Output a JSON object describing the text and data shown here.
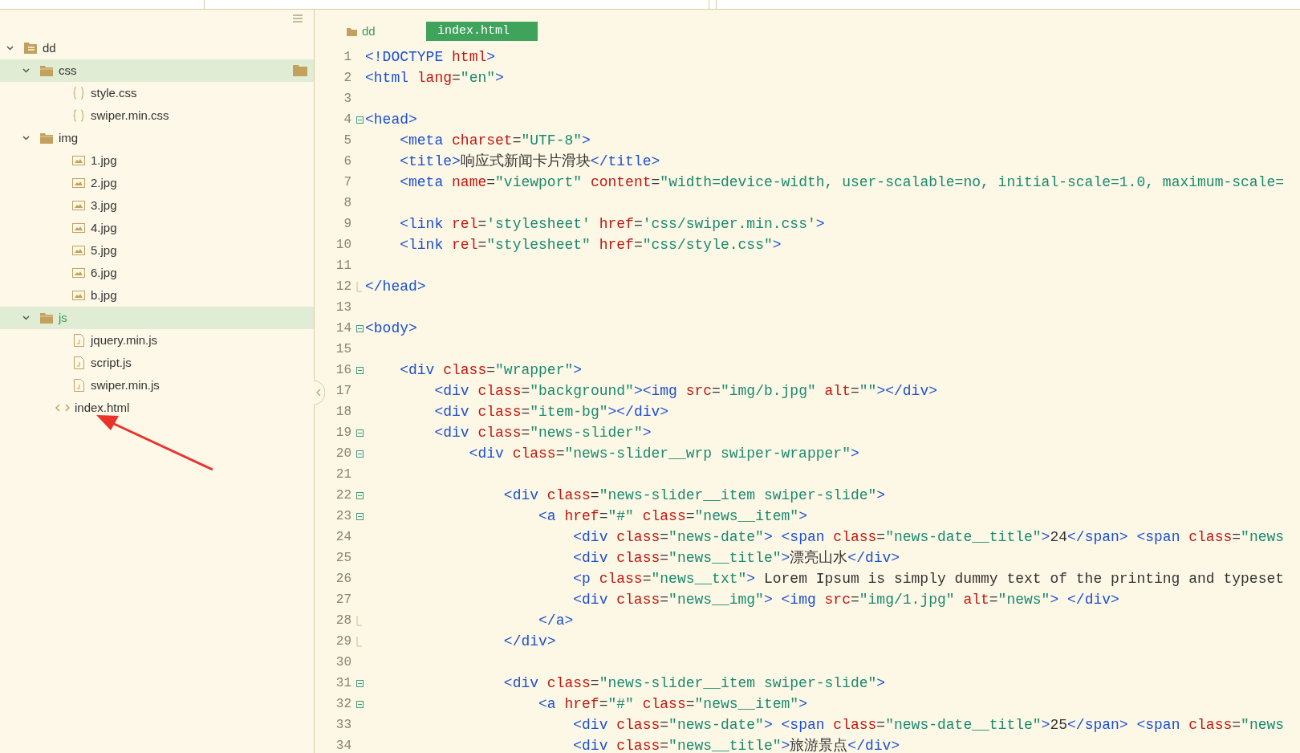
{
  "sidebar": {
    "tree": [
      {
        "label": "dd",
        "kind": "project",
        "expanded": true,
        "selected": false,
        "hovered": false,
        "children": [
          {
            "label": "css",
            "kind": "folder",
            "expanded": true,
            "selected": false,
            "hovered": true,
            "children": [
              {
                "label": "style.css",
                "kind": "css",
                "selected": false,
                "hovered": false
              },
              {
                "label": "swiper.min.css",
                "kind": "css",
                "selected": false,
                "hovered": false
              }
            ]
          },
          {
            "label": "img",
            "kind": "folder",
            "expanded": true,
            "selected": false,
            "hovered": false,
            "children": [
              {
                "label": "1.jpg",
                "kind": "image",
                "selected": false,
                "hovered": false
              },
              {
                "label": "2.jpg",
                "kind": "image",
                "selected": false,
                "hovered": false
              },
              {
                "label": "3.jpg",
                "kind": "image",
                "selected": false,
                "hovered": false
              },
              {
                "label": "4.jpg",
                "kind": "image",
                "selected": false,
                "hovered": false
              },
              {
                "label": "5.jpg",
                "kind": "image",
                "selected": false,
                "hovered": false
              },
              {
                "label": "6.jpg",
                "kind": "image",
                "selected": false,
                "hovered": false
              },
              {
                "label": "b.jpg",
                "kind": "image",
                "selected": false,
                "hovered": false
              }
            ]
          },
          {
            "label": "js",
            "kind": "folder",
            "expanded": true,
            "selected": true,
            "hovered": false,
            "children": [
              {
                "label": "jquery.min.js",
                "kind": "script",
                "selected": false,
                "hovered": false
              },
              {
                "label": "script.js",
                "kind": "script",
                "selected": false,
                "hovered": false
              },
              {
                "label": "swiper.min.js",
                "kind": "script",
                "selected": false,
                "hovered": false
              }
            ]
          },
          {
            "label": "index.html",
            "kind": "html",
            "selected": false,
            "hovered": false
          }
        ]
      }
    ]
  },
  "editor": {
    "breadcrumb": "dd",
    "tabs": [
      {
        "label": "index.html",
        "selected": true
      }
    ],
    "lines": [
      {
        "number": "1",
        "kind": "plain",
        "segments": [
          {
            "kind": "tag",
            "text": "<!DOCTYPE "
          },
          {
            "kind": "attr",
            "text": "html"
          },
          {
            "kind": "tag",
            "text": ">"
          }
        ]
      },
      {
        "number": "2",
        "kind": "plain",
        "segments": [
          {
            "kind": "tag",
            "text": "<html "
          },
          {
            "kind": "attr",
            "text": "lang"
          },
          {
            "kind": "plain",
            "text": "="
          },
          {
            "kind": "string",
            "text": "\"en\""
          },
          {
            "kind": "tag",
            "text": ">"
          }
        ]
      },
      {
        "number": "3",
        "kind": "plain"
      },
      {
        "number": "4",
        "kind": "fold_start",
        "segments": [
          {
            "kind": "tag",
            "text": "<head>"
          }
        ]
      },
      {
        "number": "5",
        "kind": "plain",
        "segments": [
          {
            "kind": "tag",
            "text": "    <meta "
          },
          {
            "kind": "attr",
            "text": "charset"
          },
          {
            "kind": "plain",
            "text": "="
          },
          {
            "kind": "string",
            "text": "\"UTF-8\""
          },
          {
            "kind": "tag",
            "text": ">"
          }
        ]
      },
      {
        "number": "6",
        "kind": "plain",
        "segments": [
          {
            "kind": "tag",
            "text": "    <title>"
          },
          {
            "kind": "plain",
            "text": "响应式新闻卡片滑块"
          },
          {
            "kind": "tag",
            "text": "</title>"
          }
        ]
      },
      {
        "number": "7",
        "kind": "plain",
        "segments": [
          {
            "kind": "tag",
            "text": "    <meta "
          },
          {
            "kind": "attr",
            "text": "name"
          },
          {
            "kind": "plain",
            "text": "="
          },
          {
            "kind": "string",
            "text": "\"viewport\" "
          },
          {
            "kind": "attr",
            "text": "content"
          },
          {
            "kind": "plain",
            "text": "="
          },
          {
            "kind": "string",
            "text": "\"width=device-width, user-scalable=no, initial-scale=1.0, maximum-scale="
          }
        ]
      },
      {
        "number": "8",
        "kind": "plain"
      },
      {
        "number": "9",
        "kind": "plain",
        "segments": [
          {
            "kind": "tag",
            "text": "    <link "
          },
          {
            "kind": "attr",
            "text": "rel"
          },
          {
            "kind": "plain",
            "text": "="
          },
          {
            "kind": "string",
            "text": "'stylesheet' "
          },
          {
            "kind": "attr",
            "text": "href"
          },
          {
            "kind": "plain",
            "text": "="
          },
          {
            "kind": "string",
            "text": "'css/swiper.min.css'"
          },
          {
            "kind": "tag",
            "text": ">"
          }
        ]
      },
      {
        "number": "10",
        "kind": "plain",
        "segments": [
          {
            "kind": "tag",
            "text": "    <link "
          },
          {
            "kind": "attr",
            "text": "rel"
          },
          {
            "kind": "plain",
            "text": "="
          },
          {
            "kind": "string",
            "text": "\"stylesheet\" "
          },
          {
            "kind": "attr",
            "text": "href"
          },
          {
            "kind": "plain",
            "text": "="
          },
          {
            "kind": "string",
            "text": "\"css/style.css\""
          },
          {
            "kind": "tag",
            "text": ">"
          }
        ]
      },
      {
        "number": "11",
        "kind": "plain"
      },
      {
        "number": "12",
        "kind": "fold_end",
        "segments": [
          {
            "kind": "tag",
            "text": "</head>"
          }
        ]
      },
      {
        "number": "13",
        "kind": "plain"
      },
      {
        "number": "14",
        "kind": "fold_start",
        "segments": [
          {
            "kind": "tag",
            "text": "<body>"
          }
        ]
      },
      {
        "number": "15",
        "kind": "plain"
      },
      {
        "number": "16",
        "kind": "fold_start",
        "segments": [
          {
            "kind": "tag",
            "text": "    <div "
          },
          {
            "kind": "attr",
            "text": "class"
          },
          {
            "kind": "plain",
            "text": "="
          },
          {
            "kind": "string",
            "text": "\"wrapper\""
          },
          {
            "kind": "tag",
            "text": ">"
          }
        ]
      },
      {
        "number": "17",
        "kind": "plain",
        "segments": [
          {
            "kind": "tag",
            "text": "        <div "
          },
          {
            "kind": "attr",
            "text": "class"
          },
          {
            "kind": "plain",
            "text": "="
          },
          {
            "kind": "string",
            "text": "\"background\""
          },
          {
            "kind": "tag",
            "text": "><img "
          },
          {
            "kind": "attr",
            "text": "src"
          },
          {
            "kind": "plain",
            "text": "="
          },
          {
            "kind": "string",
            "text": "\"img/b.jpg\" "
          },
          {
            "kind": "attr",
            "text": "alt"
          },
          {
            "kind": "plain",
            "text": "="
          },
          {
            "kind": "string",
            "text": "\"\""
          },
          {
            "kind": "tag",
            "text": "></div>"
          }
        ]
      },
      {
        "number": "18",
        "kind": "plain",
        "segments": [
          {
            "kind": "tag",
            "text": "        <div "
          },
          {
            "kind": "attr",
            "text": "class"
          },
          {
            "kind": "plain",
            "text": "="
          },
          {
            "kind": "string",
            "text": "\"item-bg\""
          },
          {
            "kind": "tag",
            "text": "></div>"
          }
        ]
      },
      {
        "number": "19",
        "kind": "fold_start",
        "segments": [
          {
            "kind": "tag",
            "text": "        <div "
          },
          {
            "kind": "attr",
            "text": "class"
          },
          {
            "kind": "plain",
            "text": "="
          },
          {
            "kind": "string",
            "text": "\"news-slider\""
          },
          {
            "kind": "tag",
            "text": ">"
          }
        ]
      },
      {
        "number": "20",
        "kind": "fold_start",
        "segments": [
          {
            "kind": "tag",
            "text": "            <div "
          },
          {
            "kind": "attr",
            "text": "class"
          },
          {
            "kind": "plain",
            "text": "="
          },
          {
            "kind": "string",
            "text": "\"news-slider__wrp swiper-wrapper\""
          },
          {
            "kind": "tag",
            "text": ">"
          }
        ]
      },
      {
        "number": "21",
        "kind": "plain"
      },
      {
        "number": "22",
        "kind": "fold_start",
        "segments": [
          {
            "kind": "tag",
            "text": "                <div "
          },
          {
            "kind": "attr",
            "text": "class"
          },
          {
            "kind": "plain",
            "text": "="
          },
          {
            "kind": "string",
            "text": "\"news-slider__item swiper-slide\""
          },
          {
            "kind": "tag",
            "text": ">"
          }
        ]
      },
      {
        "number": "23",
        "kind": "fold_start",
        "segments": [
          {
            "kind": "tag",
            "text": "                    <a "
          },
          {
            "kind": "attr",
            "text": "href"
          },
          {
            "kind": "plain",
            "text": "="
          },
          {
            "kind": "string",
            "text": "\"#\" "
          },
          {
            "kind": "attr",
            "text": "class"
          },
          {
            "kind": "plain",
            "text": "="
          },
          {
            "kind": "string",
            "text": "\"news__item\""
          },
          {
            "kind": "tag",
            "text": ">"
          }
        ]
      },
      {
        "number": "24",
        "kind": "plain",
        "segments": [
          {
            "kind": "tag",
            "text": "                        <div "
          },
          {
            "kind": "attr",
            "text": "class"
          },
          {
            "kind": "plain",
            "text": "="
          },
          {
            "kind": "string",
            "text": "\"news-date\""
          },
          {
            "kind": "tag",
            "text": "> <span "
          },
          {
            "kind": "attr",
            "text": "class"
          },
          {
            "kind": "plain",
            "text": "="
          },
          {
            "kind": "string",
            "text": "\"news-date__title\""
          },
          {
            "kind": "tag",
            "text": ">"
          },
          {
            "kind": "plain",
            "text": "24"
          },
          {
            "kind": "tag",
            "text": "</span> <span "
          },
          {
            "kind": "attr",
            "text": "class"
          },
          {
            "kind": "plain",
            "text": "="
          },
          {
            "kind": "string",
            "text": "\"news"
          }
        ]
      },
      {
        "number": "25",
        "kind": "plain",
        "segments": [
          {
            "kind": "tag",
            "text": "                        <div "
          },
          {
            "kind": "attr",
            "text": "class"
          },
          {
            "kind": "plain",
            "text": "="
          },
          {
            "kind": "string",
            "text": "\"news__title\""
          },
          {
            "kind": "tag",
            "text": ">"
          },
          {
            "kind": "plain",
            "text": "漂亮山水"
          },
          {
            "kind": "tag",
            "text": "</div>"
          }
        ]
      },
      {
        "number": "26",
        "kind": "plain",
        "segments": [
          {
            "kind": "tag",
            "text": "                        <p "
          },
          {
            "kind": "attr",
            "text": "class"
          },
          {
            "kind": "plain",
            "text": "="
          },
          {
            "kind": "string",
            "text": "\"news__txt\""
          },
          {
            "kind": "tag",
            "text": ">"
          },
          {
            "kind": "plain",
            "text": " Lorem Ipsum is simply dummy text of the printing and typeset"
          }
        ]
      },
      {
        "number": "27",
        "kind": "plain",
        "segments": [
          {
            "kind": "tag",
            "text": "                        <div "
          },
          {
            "kind": "attr",
            "text": "class"
          },
          {
            "kind": "plain",
            "text": "="
          },
          {
            "kind": "string",
            "text": "\"news__img\""
          },
          {
            "kind": "tag",
            "text": "> <img "
          },
          {
            "kind": "attr",
            "text": "src"
          },
          {
            "kind": "plain",
            "text": "="
          },
          {
            "kind": "string",
            "text": "\"img/1.jpg\" "
          },
          {
            "kind": "attr",
            "text": "alt"
          },
          {
            "kind": "plain",
            "text": "="
          },
          {
            "kind": "string",
            "text": "\"news\""
          },
          {
            "kind": "tag",
            "text": "> </div>"
          }
        ]
      },
      {
        "number": "28",
        "kind": "fold_end",
        "segments": [
          {
            "kind": "tag",
            "text": "                    </a>"
          }
        ]
      },
      {
        "number": "29",
        "kind": "fold_end",
        "segments": [
          {
            "kind": "tag",
            "text": "                </div>"
          }
        ]
      },
      {
        "number": "30",
        "kind": "plain"
      },
      {
        "number": "31",
        "kind": "fold_start",
        "segments": [
          {
            "kind": "tag",
            "text": "                <div "
          },
          {
            "kind": "attr",
            "text": "class"
          },
          {
            "kind": "plain",
            "text": "="
          },
          {
            "kind": "string",
            "text": "\"news-slider__item swiper-slide\""
          },
          {
            "kind": "tag",
            "text": ">"
          }
        ]
      },
      {
        "number": "32",
        "kind": "fold_start",
        "segments": [
          {
            "kind": "tag",
            "text": "                    <a "
          },
          {
            "kind": "attr",
            "text": "href"
          },
          {
            "kind": "plain",
            "text": "="
          },
          {
            "kind": "string",
            "text": "\"#\" "
          },
          {
            "kind": "attr",
            "text": "class"
          },
          {
            "kind": "plain",
            "text": "="
          },
          {
            "kind": "string",
            "text": "\"news__item\""
          },
          {
            "kind": "tag",
            "text": ">"
          }
        ]
      },
      {
        "number": "33",
        "kind": "plain",
        "segments": [
          {
            "kind": "tag",
            "text": "                        <div "
          },
          {
            "kind": "attr",
            "text": "class"
          },
          {
            "kind": "plain",
            "text": "="
          },
          {
            "kind": "string",
            "text": "\"news-date\""
          },
          {
            "kind": "tag",
            "text": "> <span "
          },
          {
            "kind": "attr",
            "text": "class"
          },
          {
            "kind": "plain",
            "text": "="
          },
          {
            "kind": "string",
            "text": "\"news-date__title\""
          },
          {
            "kind": "tag",
            "text": ">"
          },
          {
            "kind": "plain",
            "text": "25"
          },
          {
            "kind": "tag",
            "text": "</span> <span "
          },
          {
            "kind": "attr",
            "text": "class"
          },
          {
            "kind": "plain",
            "text": "="
          },
          {
            "kind": "string",
            "text": "\"news"
          }
        ]
      },
      {
        "number": "34",
        "kind": "plain",
        "segments": [
          {
            "kind": "tag",
            "text": "                        <div "
          },
          {
            "kind": "attr",
            "text": "class"
          },
          {
            "kind": "plain",
            "text": "="
          },
          {
            "kind": "string",
            "text": "\"news__title\""
          },
          {
            "kind": "tag",
            "text": ">"
          },
          {
            "kind": "plain",
            "text": "旅游景点"
          },
          {
            "kind": "tag",
            "text": "</div>"
          }
        ]
      }
    ]
  }
}
